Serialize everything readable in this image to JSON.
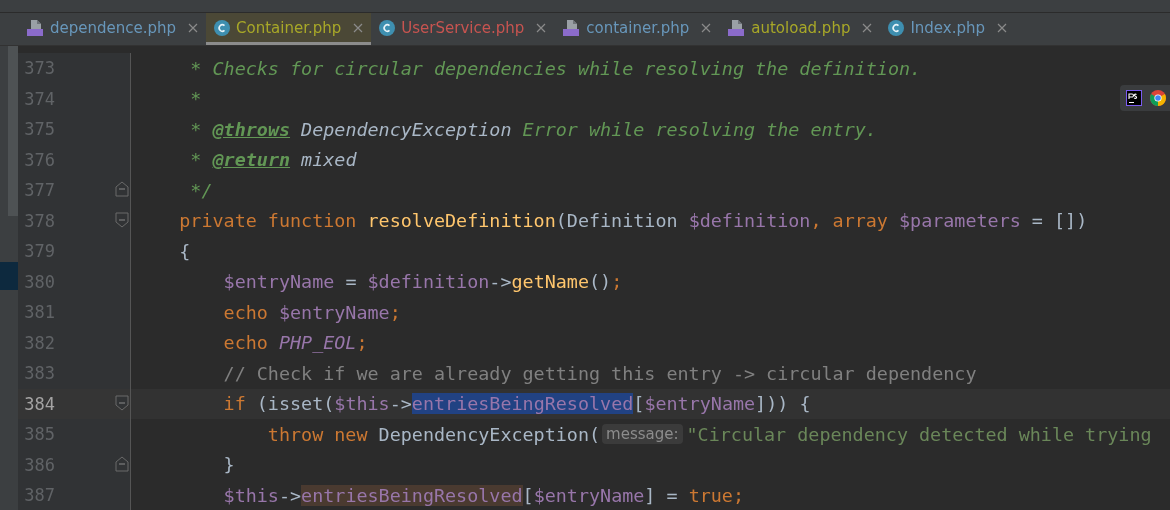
{
  "tabs": [
    {
      "label": "dependence.php",
      "kind": "php",
      "color": "#6897bb",
      "selected": false
    },
    {
      "label": "Container.php",
      "kind": "class",
      "color": "#a8a828",
      "selected": true
    },
    {
      "label": "UserService.php",
      "kind": "class",
      "color": "#c75450",
      "selected": false
    },
    {
      "label": "container.php",
      "kind": "php",
      "color": "#6897bb",
      "selected": false
    },
    {
      "label": "autoload.php",
      "kind": "php",
      "color": "#a8a828",
      "selected": false
    },
    {
      "label": "Index.php",
      "kind": "class",
      "color": "#6897bb",
      "selected": false
    }
  ],
  "editor": {
    "lines": [
      {
        "number": "373",
        "current": false,
        "tokens": [
          {
            "kind": "doc",
            "text": "     * Checks for circular dependencies while resolving the definition."
          }
        ]
      },
      {
        "number": "374",
        "current": false,
        "tokens": [
          {
            "kind": "doc",
            "text": "     *"
          }
        ]
      },
      {
        "number": "375",
        "current": false,
        "tokens": [
          {
            "kind": "doc",
            "text": "     * "
          },
          {
            "kind": "doctag",
            "text": "@throws"
          },
          {
            "kind": "doctype",
            "text": " DependencyException"
          },
          {
            "kind": "doc",
            "text": " Error while resolving the entry."
          }
        ]
      },
      {
        "number": "376",
        "current": false,
        "tokens": [
          {
            "kind": "doc",
            "text": "     * "
          },
          {
            "kind": "doctag",
            "text": "@return"
          },
          {
            "kind": "doctype",
            "text": " mixed"
          }
        ]
      },
      {
        "number": "377",
        "current": false,
        "fold_end": true,
        "tokens": [
          {
            "kind": "doc",
            "text": "     */"
          }
        ]
      },
      {
        "number": "378",
        "current": false,
        "fold_start": true,
        "tokens": [
          {
            "kind": "keyword",
            "text": "    private function "
          },
          {
            "kind": "function",
            "text": "resolveDefinition"
          },
          {
            "kind": "plain",
            "text": "(Definition "
          },
          {
            "kind": "variable",
            "text": "$definition"
          },
          {
            "kind": "keyword",
            "text": ", array "
          },
          {
            "kind": "variable",
            "text": "$parameters"
          },
          {
            "kind": "plain",
            "text": " = [])"
          }
        ]
      },
      {
        "number": "379",
        "current": false,
        "tokens": [
          {
            "kind": "plain",
            "text": "    {"
          }
        ]
      },
      {
        "number": "380",
        "current": false,
        "tokens": [
          {
            "kind": "variable",
            "text": "        $entryName"
          },
          {
            "kind": "plain",
            "text": " = "
          },
          {
            "kind": "variable",
            "text": "$definition"
          },
          {
            "kind": "plain",
            "text": "->"
          },
          {
            "kind": "function",
            "text": "getName"
          },
          {
            "kind": "plain",
            "text": "()"
          },
          {
            "kind": "keyword",
            "text": ";"
          }
        ]
      },
      {
        "number": "381",
        "current": false,
        "tokens": [
          {
            "kind": "keyword",
            "text": "        echo "
          },
          {
            "kind": "variable",
            "text": "$entryName"
          },
          {
            "kind": "keyword",
            "text": ";"
          }
        ]
      },
      {
        "number": "382",
        "current": false,
        "tokens": [
          {
            "kind": "keyword",
            "text": "        echo "
          },
          {
            "kind": "constant",
            "text": "PHP_EOL"
          },
          {
            "kind": "keyword",
            "text": ";"
          }
        ]
      },
      {
        "number": "383",
        "current": false,
        "tokens": [
          {
            "kind": "comment",
            "text": "        // Check if we are already getting this entry -> circular dependency"
          }
        ]
      },
      {
        "number": "384",
        "current": true,
        "fold_start": true,
        "tokens": [
          {
            "kind": "keyword",
            "text": "        if "
          },
          {
            "kind": "plain",
            "text": "(isset("
          },
          {
            "kind": "variable",
            "text": "$this"
          },
          {
            "kind": "plain",
            "text": "->"
          },
          {
            "kind": "variable",
            "text": "entriesBeingResolved",
            "selected": true
          },
          {
            "kind": "plain",
            "text": "["
          },
          {
            "kind": "variable",
            "text": "$entryName"
          },
          {
            "kind": "plain",
            "text": "])) {"
          }
        ]
      },
      {
        "number": "385",
        "current": false,
        "tokens": [
          {
            "kind": "keyword",
            "text": "            throw new "
          },
          {
            "kind": "plain",
            "text": "DependencyException("
          },
          {
            "kind": "hint",
            "text": "message:"
          },
          {
            "kind": "string",
            "text": "\"Circular dependency detected while trying"
          }
        ]
      },
      {
        "number": "386",
        "current": false,
        "fold_end": true,
        "tokens": [
          {
            "kind": "plain",
            "text": "        }"
          }
        ]
      },
      {
        "number": "387",
        "current": false,
        "tokens": [
          {
            "kind": "variable",
            "text": "        $this"
          },
          {
            "kind": "plain",
            "text": "->"
          },
          {
            "kind": "variable",
            "text": "entriesBeingResolved",
            "highlighted": true
          },
          {
            "kind": "plain",
            "text": "["
          },
          {
            "kind": "variable",
            "text": "$entryName"
          },
          {
            "kind": "plain",
            "text": "] = "
          },
          {
            "kind": "keyword",
            "text": "true;"
          }
        ]
      }
    ]
  }
}
